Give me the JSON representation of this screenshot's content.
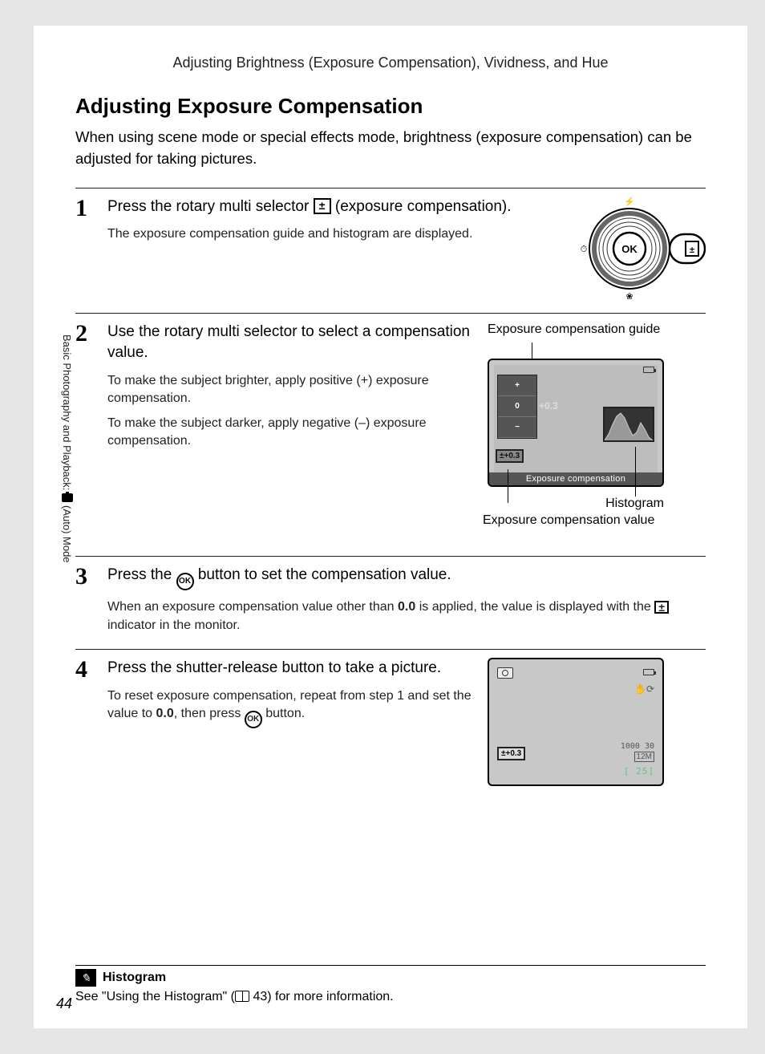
{
  "breadcrumb": "Adjusting Brightness (Exposure Compensation), Vividness, and Hue",
  "heading": "Adjusting Exposure Compensation",
  "intro": "When using scene mode or special effects mode, brightness (exposure compensation) can be adjusted for taking pictures.",
  "side_label_before": "Basic Photography and Playback: ",
  "side_label_after": " (Auto) Mode",
  "steps": {
    "s1": {
      "num": "1",
      "title_before": "Press the rotary multi selector ",
      "title_after": " (exposure compensation).",
      "desc1": "The exposure compensation guide and histogram are displayed."
    },
    "s2": {
      "num": "2",
      "title": "Use the rotary multi selector to select a compensation value.",
      "desc1": "To make the subject brighter, apply positive (+) exposure compensation.",
      "desc2": "To make the subject darker, apply negative (–) exposure compensation.",
      "guide_label": "Exposure compensation guide",
      "ev_value": "+0.3",
      "ec_badge": "±+0.3",
      "caption": "Exposure compensation",
      "hist_label": "Histogram",
      "ecv_label": "Exposure compensation value"
    },
    "s3": {
      "num": "3",
      "title_before": "Press the ",
      "title_after": " button to set the compensation value.",
      "desc_before": "When an exposure compensation value other than ",
      "desc_bold": "0.0",
      "desc_mid": " is applied, the value is displayed with the ",
      "desc_after": " indicator in the monitor."
    },
    "s4": {
      "num": "4",
      "title": "Press the shutter-release button to take a picture.",
      "desc_before": "To reset exposure compensation, repeat from step 1 and set the value to ",
      "desc_bold": "0.0",
      "desc_mid": ", then press ",
      "desc_after": " button.",
      "ec_badge": "±+0.3",
      "clock": "1000 30",
      "twelvem": "12M",
      "remain": "[   25]"
    }
  },
  "footnote": {
    "title": "Histogram",
    "body_before": "See \"Using the Histogram\" (",
    "body_page": " 43) for more information."
  },
  "page_number": "44",
  "ev_scale": {
    "plus": "+",
    "zero": "0",
    "minus": "−"
  },
  "ok_label": "OK"
}
